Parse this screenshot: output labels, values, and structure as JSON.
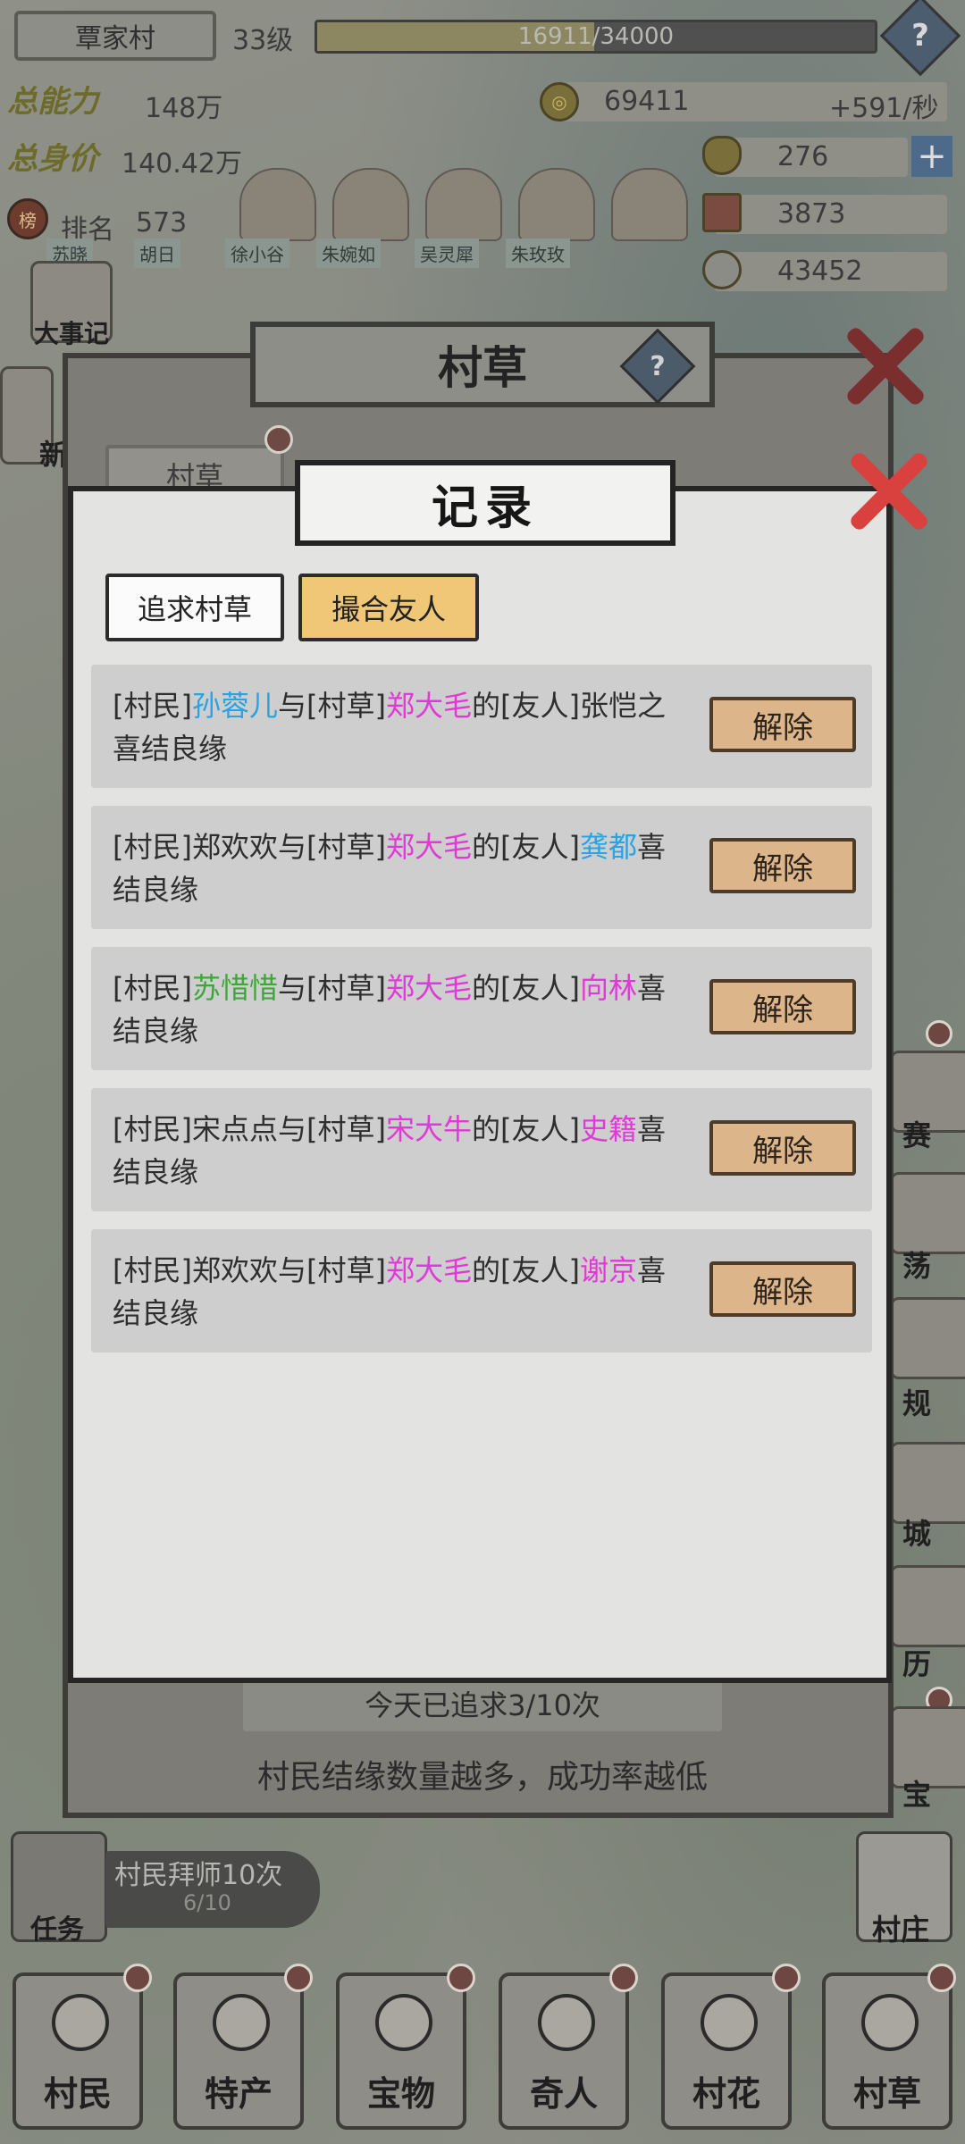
{
  "hud": {
    "village_name": "覃家村",
    "level": "33级",
    "exp_text": "16911/34000",
    "exp_fraction": 0.497,
    "stats": {
      "total_ability_label": "总能力",
      "total_ability_value": "148万",
      "total_value_label": "总身价",
      "total_value_value": "140.42万",
      "rank_label": "排名",
      "rank_value": "573",
      "coins": "69411",
      "coin_rate": "+591/秒",
      "gold": "276",
      "tickets": "3873",
      "silver": "43452"
    },
    "rank_names": [
      "苏晓",
      "胡日",
      "徐小谷",
      "朱婉如",
      "吴灵犀",
      "朱玫玫"
    ]
  },
  "side": {
    "events_label": "大事记",
    "new_label": "新"
  },
  "right_side": [
    "赛",
    "荡",
    "规",
    "城",
    "历",
    "宝"
  ],
  "back_panel": {
    "title": "村草",
    "tab_label": "村草",
    "footer_count": "今天已追求3/10次",
    "footer_hint": "村民结缘数量越多，成功率越低"
  },
  "record_panel": {
    "title": "记录",
    "tabs": [
      "追求村草",
      "撮合友人"
    ],
    "unbind_label": "解除",
    "records": [
      {
        "p1": "[村民]",
        "n1": "孙蓉儿",
        "p2": "与[村草]",
        "n2": "郑大毛",
        "p3": "的[友人]张恺之喜结良缘",
        "n3": ""
      },
      {
        "p1": "[村民]郑欢欢",
        "n1": "",
        "p2": "与[村草]",
        "n2": "郑大毛",
        "p3": "的[友人]",
        "n3": "龚都",
        "tail": "喜结良缘"
      },
      {
        "p1": "[村民]",
        "n1": "苏惜惜",
        "p2": "与[村草]",
        "n2": "郑大毛",
        "p3": "的[友人]",
        "n3": "向林",
        "tail": "喜结良缘"
      },
      {
        "p1": "[村民]宋点点",
        "n1": "",
        "p2": "与[村草]",
        "n2": "宋大牛",
        "p3": "的[友人]",
        "n3": "史籍",
        "tail": "喜结良缘"
      },
      {
        "p1": "[村民]郑欢欢",
        "n1": "",
        "p2": "与[村草]",
        "n2": "郑大毛",
        "p3": "的[友人]",
        "n3": "谢京",
        "tail": "喜结良缘"
      }
    ]
  },
  "task": {
    "label": "任务",
    "text": "村民拜师10次",
    "progress": "6/10"
  },
  "village_btn": "村庄",
  "nav": [
    "村民",
    "特产",
    "宝物",
    "奇人",
    "村花",
    "村草"
  ],
  "colors": {
    "tab_active": "#f0c777",
    "unbind_bg": "#dcb58a",
    "highlight_blue": "#29a3e3",
    "highlight_pink": "#e039d8",
    "highlight_green": "#3ea63a",
    "close_red": "#d9413f"
  }
}
